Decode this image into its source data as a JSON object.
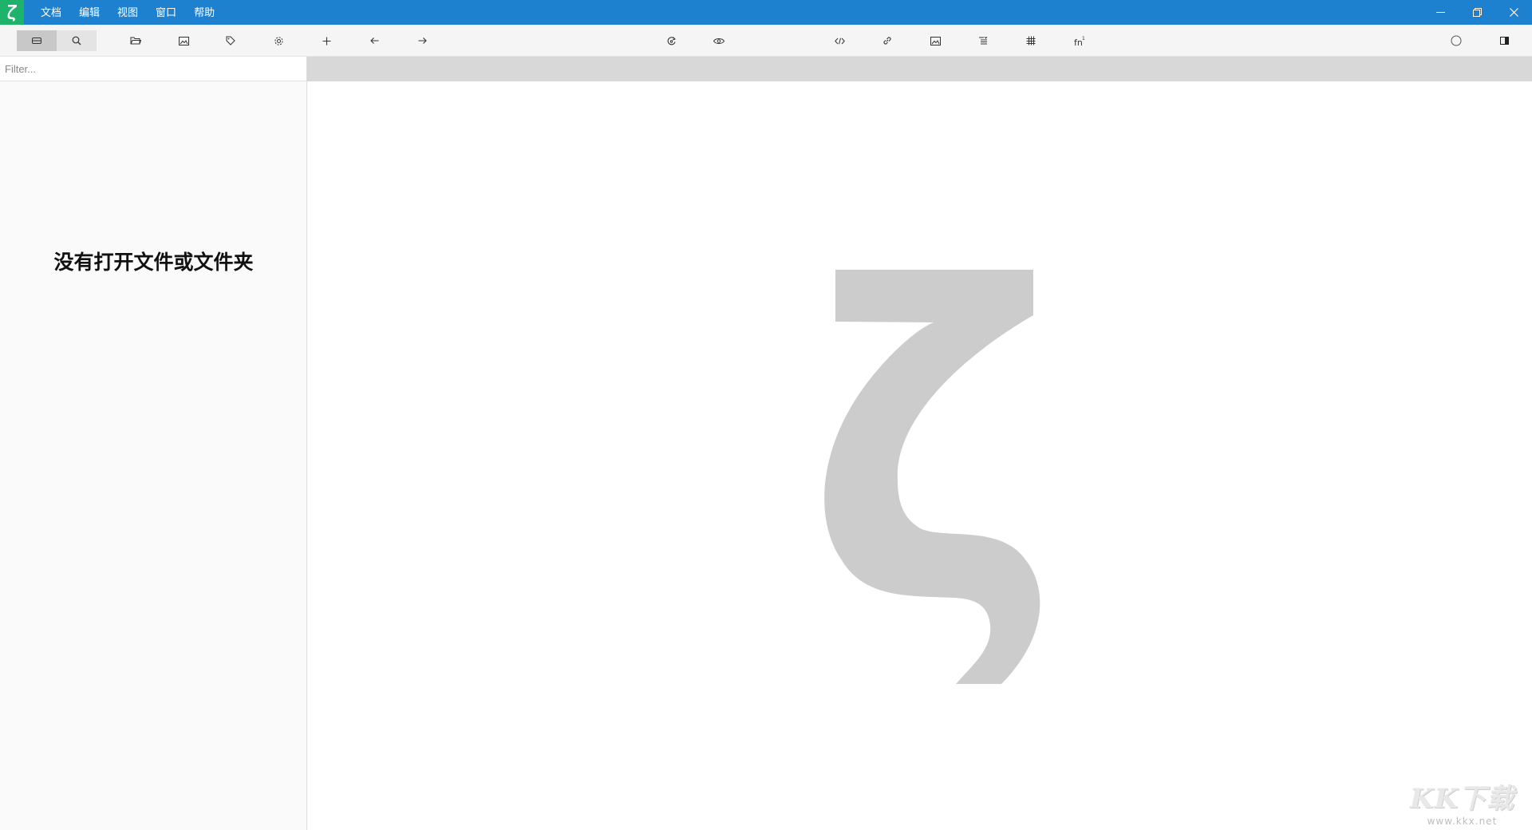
{
  "menu": {
    "items": [
      "文档",
      "编辑",
      "视图",
      "窗口",
      "帮助"
    ]
  },
  "toolbar": {
    "segments": [
      {
        "name": "file-manager",
        "icon": "drive-icon",
        "active": true
      },
      {
        "name": "global-search",
        "icon": "search-icon",
        "active": false
      }
    ],
    "left_buttons": [
      "folder-open-icon",
      "image-icon",
      "tag-icon",
      "gear-icon",
      "plus-icon",
      "arrow-left-icon",
      "arrow-right-icon"
    ],
    "center_buttons": [
      "refresh-icon",
      "eye-icon",
      "code-icon",
      "link-icon",
      "image-icon",
      "list-icon",
      "table-icon",
      "footnote-icon"
    ],
    "right_buttons": [
      "circle-icon",
      "sidebar-toggle-icon"
    ]
  },
  "sidebar": {
    "filter_placeholder": "Filter...",
    "empty_message": "没有打开文件或文件夹"
  },
  "watermark": {
    "brand": "KK下载",
    "url": "www.kkx.net"
  },
  "colors": {
    "titlebar": "#1e81d0",
    "logo": "#1db36b",
    "toolbar": "#f5f5f5",
    "tabbar": "#d8d8d8",
    "watermark_logo": "#cccccc"
  }
}
